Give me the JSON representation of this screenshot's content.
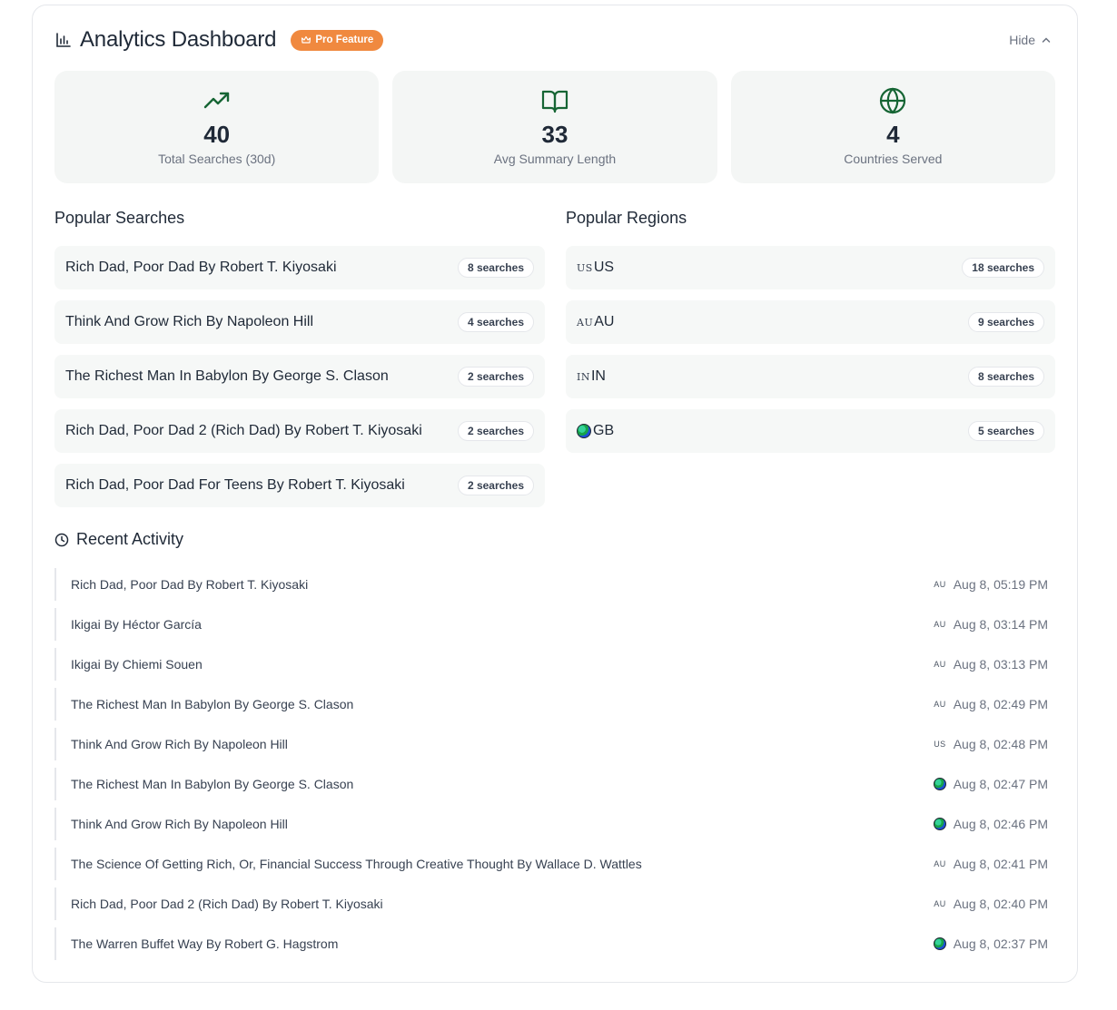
{
  "header": {
    "title": "Analytics Dashboard",
    "badge": "Pro Feature",
    "hide_label": "Hide"
  },
  "stats": [
    {
      "value": "40",
      "label": "Total Searches (30d)",
      "icon": "trending-up-icon"
    },
    {
      "value": "33",
      "label": "Avg Summary Length",
      "icon": "book-open-icon"
    },
    {
      "value": "4",
      "label": "Countries Served",
      "icon": "globe-icon"
    }
  ],
  "popular_searches": {
    "title": "Popular Searches",
    "items": [
      {
        "label": "Rich Dad, Poor Dad By Robert T. Kiyosaki",
        "count": "8 searches"
      },
      {
        "label": "Think And Grow Rich By Napoleon Hill",
        "count": "4 searches"
      },
      {
        "label": "The Richest Man In Babylon By George S. Clason",
        "count": "2 searches"
      },
      {
        "label": "Rich Dad, Poor Dad 2 (Rich Dad) By Robert T. Kiyosaki",
        "count": "2 searches"
      },
      {
        "label": "Rich Dad, Poor Dad For Teens By Robert T. Kiyosaki",
        "count": "2 searches"
      }
    ]
  },
  "popular_regions": {
    "title": "Popular Regions",
    "items": [
      {
        "flag": "US",
        "label": "US",
        "count": "18 searches"
      },
      {
        "flag": "AU",
        "label": "AU",
        "count": "9 searches"
      },
      {
        "flag": "IN",
        "label": "IN",
        "count": "8 searches"
      },
      {
        "flag": "globe",
        "label": "GB",
        "count": "5 searches"
      }
    ]
  },
  "recent_activity": {
    "title": "Recent Activity",
    "items": [
      {
        "label": "Rich Dad, Poor Dad By Robert T. Kiyosaki",
        "flag": "AU",
        "time": "Aug 8, 05:19 PM"
      },
      {
        "label": "Ikigai By Héctor García",
        "flag": "AU",
        "time": "Aug 8, 03:14 PM"
      },
      {
        "label": "Ikigai By Chiemi Souen",
        "flag": "AU",
        "time": "Aug 8, 03:13 PM"
      },
      {
        "label": "The Richest Man In Babylon By George S. Clason",
        "flag": "AU",
        "time": "Aug 8, 02:49 PM"
      },
      {
        "label": "Think And Grow Rich By Napoleon Hill",
        "flag": "US",
        "time": "Aug 8, 02:48 PM"
      },
      {
        "label": "The Richest Man In Babylon By George S. Clason",
        "flag": "globe",
        "time": "Aug 8, 02:47 PM"
      },
      {
        "label": "Think And Grow Rich By Napoleon Hill",
        "flag": "globe",
        "time": "Aug 8, 02:46 PM"
      },
      {
        "label": "The Science Of Getting Rich, Or, Financial Success Through Creative Thought By Wallace D. Wattles",
        "flag": "AU",
        "time": "Aug 8, 02:41 PM"
      },
      {
        "label": "Rich Dad, Poor Dad 2 (Rich Dad) By Robert T. Kiyosaki",
        "flag": "AU",
        "time": "Aug 8, 02:40 PM"
      },
      {
        "label": "The Warren Buffet Way By Robert G. Hagstrom",
        "flag": "globe",
        "time": "Aug 8, 02:37 PM"
      }
    ]
  },
  "colors": {
    "accent_green": "#166534",
    "badge_orange": "#f0893f"
  }
}
